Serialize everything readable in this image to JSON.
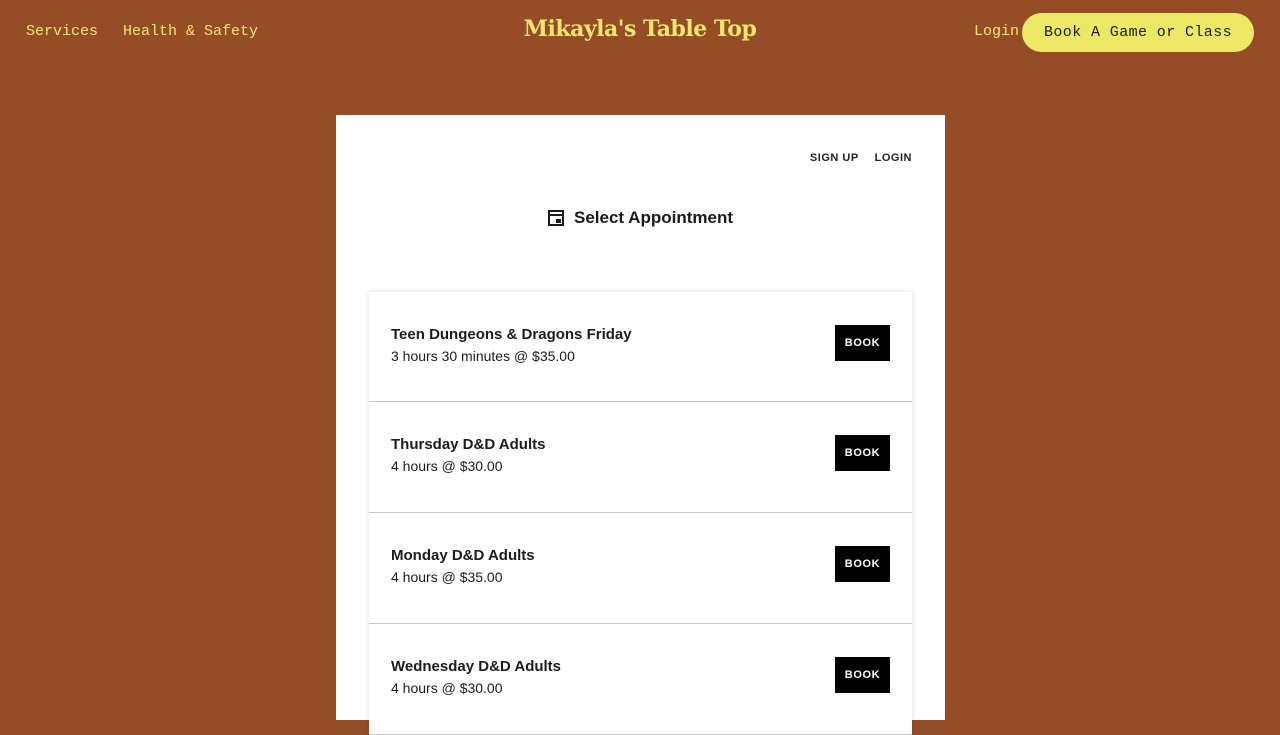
{
  "header": {
    "nav": [
      "Services",
      "Health & Safety"
    ],
    "site_title": "Mikayla's Table Top",
    "login_label": "Login",
    "cta_label": "Book A Game or Class"
  },
  "scheduler": {
    "sign_up_label": "SIGN UP",
    "login_label": "LOGIN",
    "title": "Select Appointment",
    "book_label": "BOOK",
    "appointments": [
      {
        "name": "Teen Dungeons & Dragons Friday",
        "details": "3 hours 30 minutes @ $35.00"
      },
      {
        "name": "Thursday D&D Adults",
        "details": "4 hours @ $30.00"
      },
      {
        "name": "Monday D&D Adults",
        "details": "4 hours @ $35.00"
      },
      {
        "name": "Wednesday D&D Adults",
        "details": "4 hours @ $30.00"
      }
    ]
  },
  "colors": {
    "page_background": "#974c28",
    "accent_text": "#f1e66d",
    "cta_background": "#ece865",
    "book_button": "#000000"
  }
}
